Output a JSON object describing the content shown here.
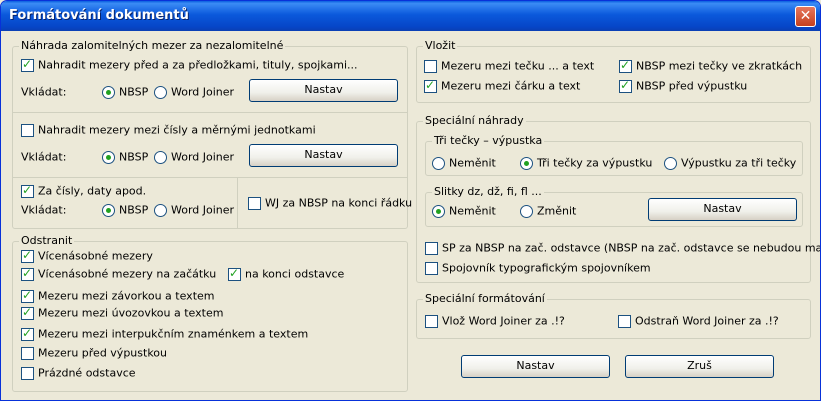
{
  "window": {
    "title": "Formátování dokumentů",
    "close_label": "✕"
  },
  "left": {
    "group1": {
      "title": "Náhrada zalomitelných mezer za nezalomitelné",
      "opt1": {
        "label": "Nahradit mezery před a za předložkami, tituly, spojkami...",
        "checked": true
      },
      "insert1": {
        "label": "Vkládat:",
        "nbsp": "NBSP",
        "wj": "Word Joiner",
        "selected": "nbsp",
        "button": "Nastav"
      },
      "opt2": {
        "label": "Nahradit mezery mezi čísly a měrnými jednotkami",
        "checked": false
      },
      "insert2": {
        "label": "Vkládat:",
        "nbsp": "NBSP",
        "wj": "Word Joiner",
        "selected": "nbsp",
        "button": "Nastav"
      },
      "opt3": {
        "label": "Za čísly, daty apod.",
        "checked": true
      },
      "insert3": {
        "label": "Vkládat:",
        "nbsp": "NBSP",
        "wj": "Word Joiner",
        "selected": "nbsp"
      },
      "wj_nbsp": {
        "label": "WJ za NBSP na konci řádku",
        "checked": false
      }
    },
    "group2": {
      "title": "Odstranit",
      "items": [
        {
          "label": "Vícenásobné mezery",
          "checked": true
        },
        {
          "label": "Vícenásobné mezery na začátku",
          "checked": true
        },
        {
          "label": "na konci odstavce",
          "checked": true
        },
        {
          "label": "Mezeru mezi závorkou a textem",
          "checked": true
        },
        {
          "label": "Mezeru mezi úvozovkou a textem",
          "checked": true
        },
        {
          "label": "Mezeru mezi interpukčním znaménkem a textem",
          "checked": true
        },
        {
          "label": "Mezeru před výpustkou",
          "checked": false
        },
        {
          "label": "Prázdné odstavce",
          "checked": false
        }
      ]
    }
  },
  "right": {
    "insert": {
      "title": "Vložit",
      "items": [
        {
          "label": "Mezeru mezi tečku ... a text",
          "checked": false
        },
        {
          "label": "NBSP mezi tečky ve zkratkách",
          "checked": true
        },
        {
          "label": "Mezeru mezi čárku a text",
          "checked": true
        },
        {
          "label": "NBSP před výpustku",
          "checked": true
        }
      ]
    },
    "special": {
      "title": "Speciální náhrady",
      "dots": {
        "title": "Tři tečky – výpustka",
        "options": [
          "Neměnit",
          "Tři tečky za výpustku",
          "Výpustku za tři tečky"
        ],
        "selected": 1
      },
      "ligatures": {
        "title": "Slitky dz, dž, fi, fl ...",
        "options": [
          "Neměnit",
          "Změnit"
        ],
        "selected": 0,
        "button": "Nastav"
      },
      "sp_nbsp": {
        "label": "SP za NBSP na zač. odstavce (NBSP na zač. odstavce se nebudou mazat!)",
        "checked": false
      },
      "hyphen": {
        "label": "Spojovník typografickým spojovníkem",
        "checked": false
      }
    },
    "formatting": {
      "title": "Speciální formátování",
      "insert_wj": {
        "label": "Vlož Word Joiner za .!?",
        "checked": false
      },
      "remove_wj": {
        "label": "Odstraň Word Joiner za .!?",
        "checked": false
      }
    },
    "buttons": {
      "ok": "Nastav",
      "cancel": "Zruš"
    }
  }
}
